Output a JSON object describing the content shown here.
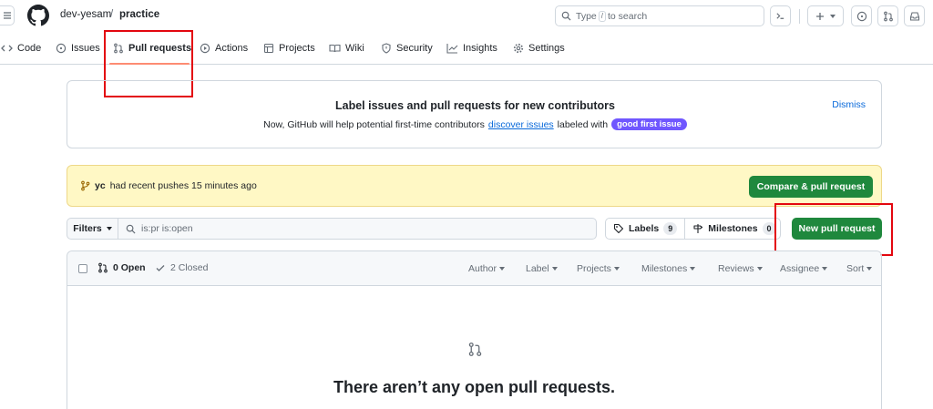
{
  "header": {
    "owner": "dev-yesam",
    "separator": "/",
    "repo": "practice",
    "search_prefix": "Type",
    "search_key": "/",
    "search_suffix": "to search"
  },
  "nav": {
    "code": "Code",
    "issues": "Issues",
    "pull_requests": "Pull requests",
    "actions": "Actions",
    "projects": "Projects",
    "wiki": "Wiki",
    "security": "Security",
    "insights": "Insights",
    "settings": "Settings",
    "active": "pull_requests"
  },
  "banner": {
    "title": "Label issues and pull requests for new contributors",
    "text_before": "Now, GitHub will help potential first-time contributors",
    "link": "discover issues",
    "text_after": "labeled with",
    "label": "good first issue",
    "dismiss": "Dismiss"
  },
  "pushes": {
    "branch": "yc",
    "text": "had recent pushes 15 minutes ago",
    "button": "Compare & pull request"
  },
  "filter_bar": {
    "filters_label": "Filters",
    "query": "is:pr is:open",
    "labels_label": "Labels",
    "labels_count": "9",
    "milestones_label": "Milestones",
    "milestones_count": "0",
    "new_pr_label": "New pull request"
  },
  "list": {
    "open_label": "0 Open",
    "closed_label": "2 Closed",
    "filters": {
      "author": "Author",
      "label": "Label",
      "projects": "Projects",
      "milestones": "Milestones",
      "reviews": "Reviews",
      "assignee": "Assignee",
      "sort": "Sort"
    },
    "empty_title": "There aren’t any open pull requests."
  },
  "colors": {
    "primary_button": "#1f883d",
    "link": "#0969da",
    "good_first_issue": "#7057ff",
    "active_tab_underline": "#fd8c73",
    "annotation": "#e3070f",
    "push_banner": "#fff8c5"
  }
}
